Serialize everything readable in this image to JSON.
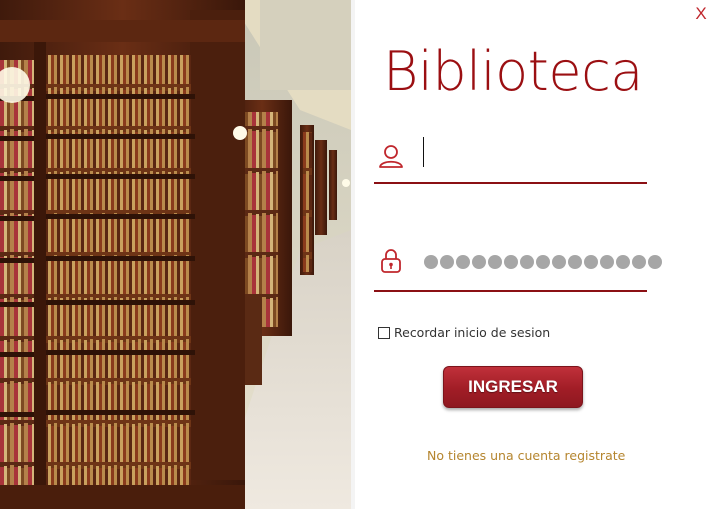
{
  "window": {
    "close_label": "X"
  },
  "login": {
    "title": "Biblioteca",
    "username_value": "",
    "password_mask": "●●●●●●●●●●●●●●●",
    "remember_label": "Recordar inicio de sesion",
    "remember_checked": false,
    "submit_label": "INGRESAR",
    "register_link": "No tienes una cuenta registrate"
  },
  "icons": {
    "username": "user-icon",
    "password": "lock-icon"
  },
  "colors": {
    "accent": "#9b0f12",
    "button": "#a11d26",
    "link": "#b5852e"
  }
}
